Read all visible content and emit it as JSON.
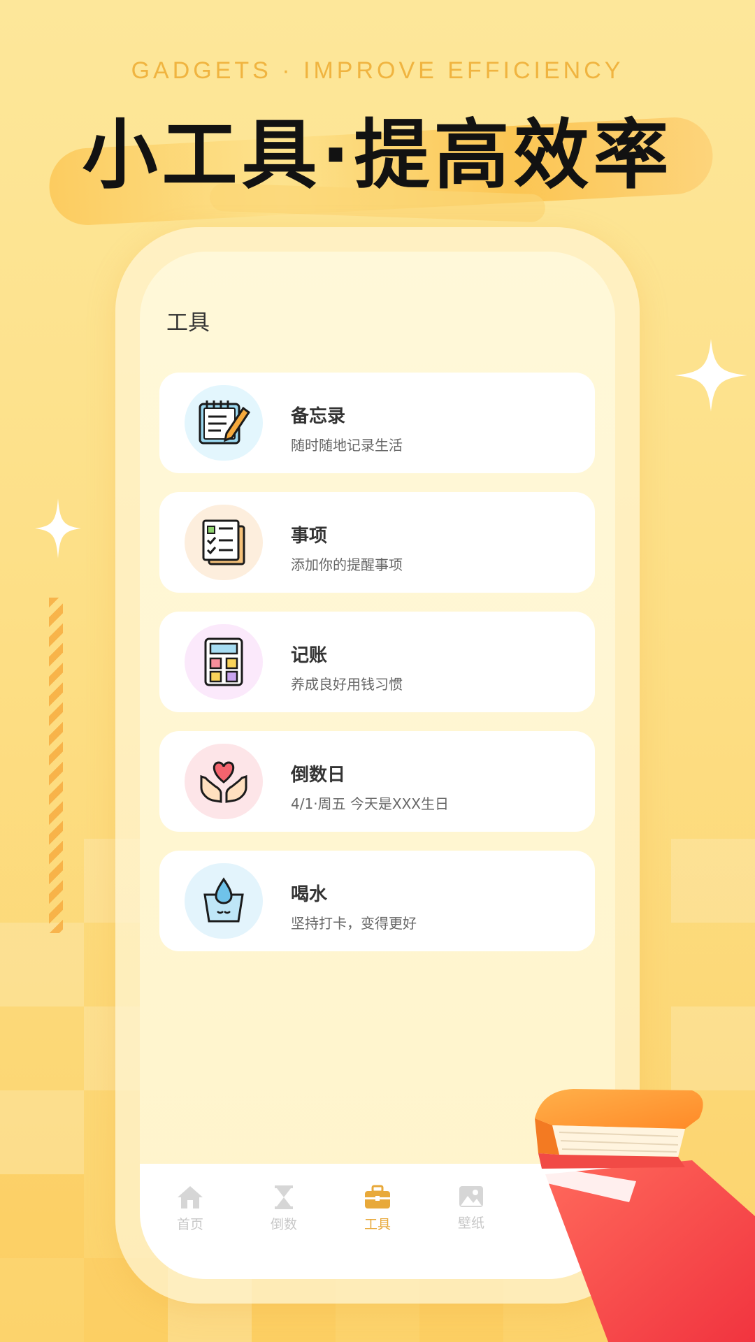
{
  "promo": {
    "subtitle": "GADGETS · IMPROVE EFFICIENCY",
    "headline": "小工具·提高效率"
  },
  "screen": {
    "title": "工具",
    "tools": [
      {
        "name": "备忘录",
        "desc": "随时随地记录生活",
        "icon": "notepad-icon",
        "bg": "#e3f6fd"
      },
      {
        "name": "事项",
        "desc": "添加你的提醒事项",
        "icon": "checklist-icon",
        "bg": "#fdeedd"
      },
      {
        "name": "记账",
        "desc": "养成良好用钱习惯",
        "icon": "calculator-icon",
        "bg": "#fbe9fb"
      },
      {
        "name": "倒数日",
        "desc": "4/1·周五   今天是XXX生日",
        "icon": "heart-hands-icon",
        "bg": "#fde5e8"
      },
      {
        "name": "喝水",
        "desc": "坚持打卡，变得更好",
        "icon": "water-cup-icon",
        "bg": "#e3f4fc"
      }
    ],
    "tabs": [
      {
        "label": "首页",
        "icon": "home-icon"
      },
      {
        "label": "倒数",
        "icon": "hourglass-icon"
      },
      {
        "label": "工具",
        "icon": "toolbox-icon",
        "active": true
      },
      {
        "label": "壁纸",
        "icon": "image-icon"
      }
    ]
  },
  "colors": {
    "accent": "#e8a93a",
    "background": "#fde79a",
    "headline": "#121212"
  }
}
